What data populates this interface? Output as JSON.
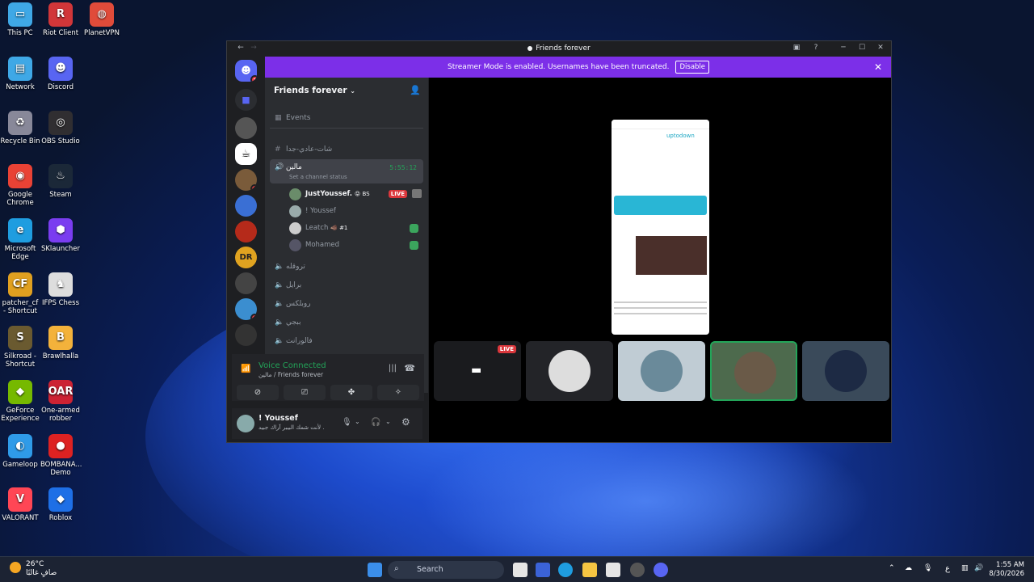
{
  "desktop": {
    "icons": [
      {
        "label": "This PC",
        "glyph": "▭",
        "color": "#3fa8e6"
      },
      {
        "label": "Network",
        "glyph": "▤",
        "color": "#3fa8e6"
      },
      {
        "label": "Recycle Bin",
        "glyph": "♻",
        "color": "#889"
      },
      {
        "label": "Google Chrome",
        "glyph": "◉",
        "color": "#e94235"
      },
      {
        "label": "Microsoft Edge",
        "glyph": "e",
        "color": "#1f9de0"
      },
      {
        "label": "patcher_cf - Shortcut",
        "glyph": "CF",
        "color": "#e0a020"
      },
      {
        "label": "Silkroad - Shortcut",
        "glyph": "S",
        "color": "#6a5a30"
      },
      {
        "label": "GeForce Experience",
        "glyph": "◆",
        "color": "#76b900"
      },
      {
        "label": "Gameloop",
        "glyph": "◐",
        "color": "#2f9be8"
      },
      {
        "label": "VALORANT",
        "glyph": "V",
        "color": "#ff4655"
      },
      {
        "label": "Riot Client",
        "glyph": "R",
        "color": "#d13639"
      },
      {
        "label": "Discord",
        "glyph": "☻",
        "color": "#5865f2"
      },
      {
        "label": "OBS Studio",
        "glyph": "◎",
        "color": "#302e31"
      },
      {
        "label": "Steam",
        "glyph": "♨",
        "color": "#1b2838"
      },
      {
        "label": "SKlauncher",
        "glyph": "⬢",
        "color": "#7a3df0"
      },
      {
        "label": "IFPS Chess",
        "glyph": "♞",
        "color": "#ddd"
      },
      {
        "label": "Brawlhalla",
        "glyph": "B",
        "color": "#f3b23b"
      },
      {
        "label": "One-armed robber",
        "glyph": "OAR",
        "color": "#c23"
      },
      {
        "label": "BOMBANA... Demo",
        "glyph": "●",
        "color": "#d22"
      },
      {
        "label": "Roblox",
        "glyph": "◆",
        "color": "#1e6fe6"
      },
      {
        "label": "PlanetVPN",
        "glyph": "◍",
        "color": "#e04b3a"
      }
    ]
  },
  "window": {
    "title": "Friends forever",
    "banner": {
      "text": "Streamer Mode is enabled. Usernames have been truncated.",
      "button": "Disable",
      "close": "✕"
    }
  },
  "guild": {
    "name": "Friends forever",
    "events": "Events",
    "channels": [
      {
        "name": "شات-عادي-جدا",
        "type": "text"
      },
      {
        "name": "مالين",
        "type": "voice",
        "timer": "5:55:12",
        "status": "Set a channel status"
      },
      {
        "name": "تروقله",
        "type": "voice"
      },
      {
        "name": "برايل",
        "type": "voice"
      },
      {
        "name": "روبلكس",
        "type": "voice"
      },
      {
        "name": "ببجي",
        "type": "voice"
      },
      {
        "name": "فالورانت",
        "type": "voice"
      }
    ],
    "voice_users": [
      {
        "name": "JustYoussef.",
        "tag": "😝 BS",
        "live": "LIVE",
        "bright": true
      },
      {
        "name": "! Youssef",
        "tag": "",
        "live": "",
        "bright": false
      },
      {
        "name": "Leatch",
        "tag": "🐗 #1",
        "live": "",
        "bright": false
      },
      {
        "name": "Mohamed",
        "tag": "",
        "live": "",
        "bright": false
      }
    ]
  },
  "voice_panel": {
    "title": "Voice Connected",
    "subtitle": "مالين / Friends forever"
  },
  "user_panel": {
    "name": "! Youssef",
    "status": "لأنت شمك البيبر آراك جبيد ."
  },
  "stage": {
    "live_label": "LIVE",
    "phone_brand": "uptodown"
  },
  "taskbar": {
    "weather_temp": "26°C",
    "weather_text": "صافٍ غالبًا",
    "search_placeholder": "Search",
    "time": "1:55 AM",
    "date": "8/30/2026",
    "lang": "ع"
  }
}
